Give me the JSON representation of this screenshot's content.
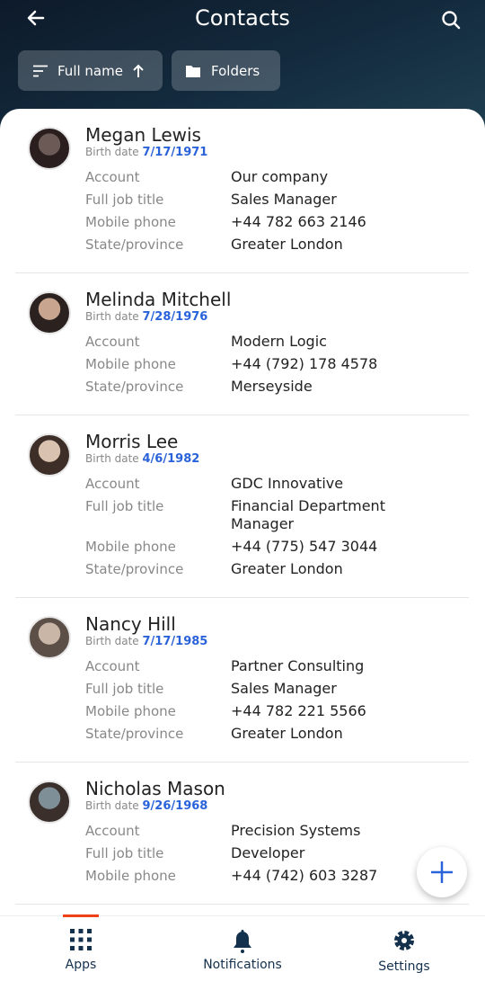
{
  "header": {
    "title": "Contacts",
    "sort_label": "Full name",
    "folders_label": "Folders"
  },
  "colors": {
    "accent": "#2a62d9",
    "nav": "#13304d",
    "indicator": "#f0401a"
  },
  "birth_label": "Birth date",
  "contacts": [
    {
      "name": "Megan Lewis",
      "birth_date": "7/17/1971",
      "fields": [
        {
          "label": "Account",
          "value": "Our company"
        },
        {
          "label": "Full job title",
          "value": "Sales Manager"
        },
        {
          "label": "Mobile phone",
          "value": "+44 782 663 2146"
        },
        {
          "label": "State/province",
          "value": "Greater London"
        }
      ]
    },
    {
      "name": "Melinda Mitchell",
      "birth_date": "7/28/1976",
      "fields": [
        {
          "label": "Account",
          "value": "Modern Logic"
        },
        {
          "label": "Mobile phone",
          "value": "+44 (792) 178 4578"
        },
        {
          "label": "State/province",
          "value": "Merseyside"
        }
      ]
    },
    {
      "name": "Morris Lee",
      "birth_date": "4/6/1982",
      "fields": [
        {
          "label": "Account",
          "value": "GDC Innovative"
        },
        {
          "label": "Full job title",
          "value": "Financial Department Manager"
        },
        {
          "label": "Mobile phone",
          "value": "+44 (775) 547 3044"
        },
        {
          "label": "State/province",
          "value": "Greater London"
        }
      ]
    },
    {
      "name": "Nancy Hill",
      "birth_date": "7/17/1985",
      "fields": [
        {
          "label": "Account",
          "value": "Partner Consulting"
        },
        {
          "label": "Full job title",
          "value": "Sales Manager"
        },
        {
          "label": "Mobile phone",
          "value": "+44 782 221 5566"
        },
        {
          "label": "State/province",
          "value": "Greater London"
        }
      ]
    },
    {
      "name": "Nicholas Mason",
      "birth_date": "9/26/1968",
      "fields": [
        {
          "label": "Account",
          "value": "Precision Systems"
        },
        {
          "label": "Full job title",
          "value": "Developer"
        },
        {
          "label": "Mobile phone",
          "value": "+44 (742) 603 3287"
        }
      ]
    }
  ],
  "nav": {
    "items": [
      {
        "label": "Apps",
        "icon": "apps-grid-icon"
      },
      {
        "label": "Notifications",
        "icon": "bell-icon"
      },
      {
        "label": "Settings",
        "icon": "gear-icon"
      }
    ],
    "active": "Apps"
  }
}
